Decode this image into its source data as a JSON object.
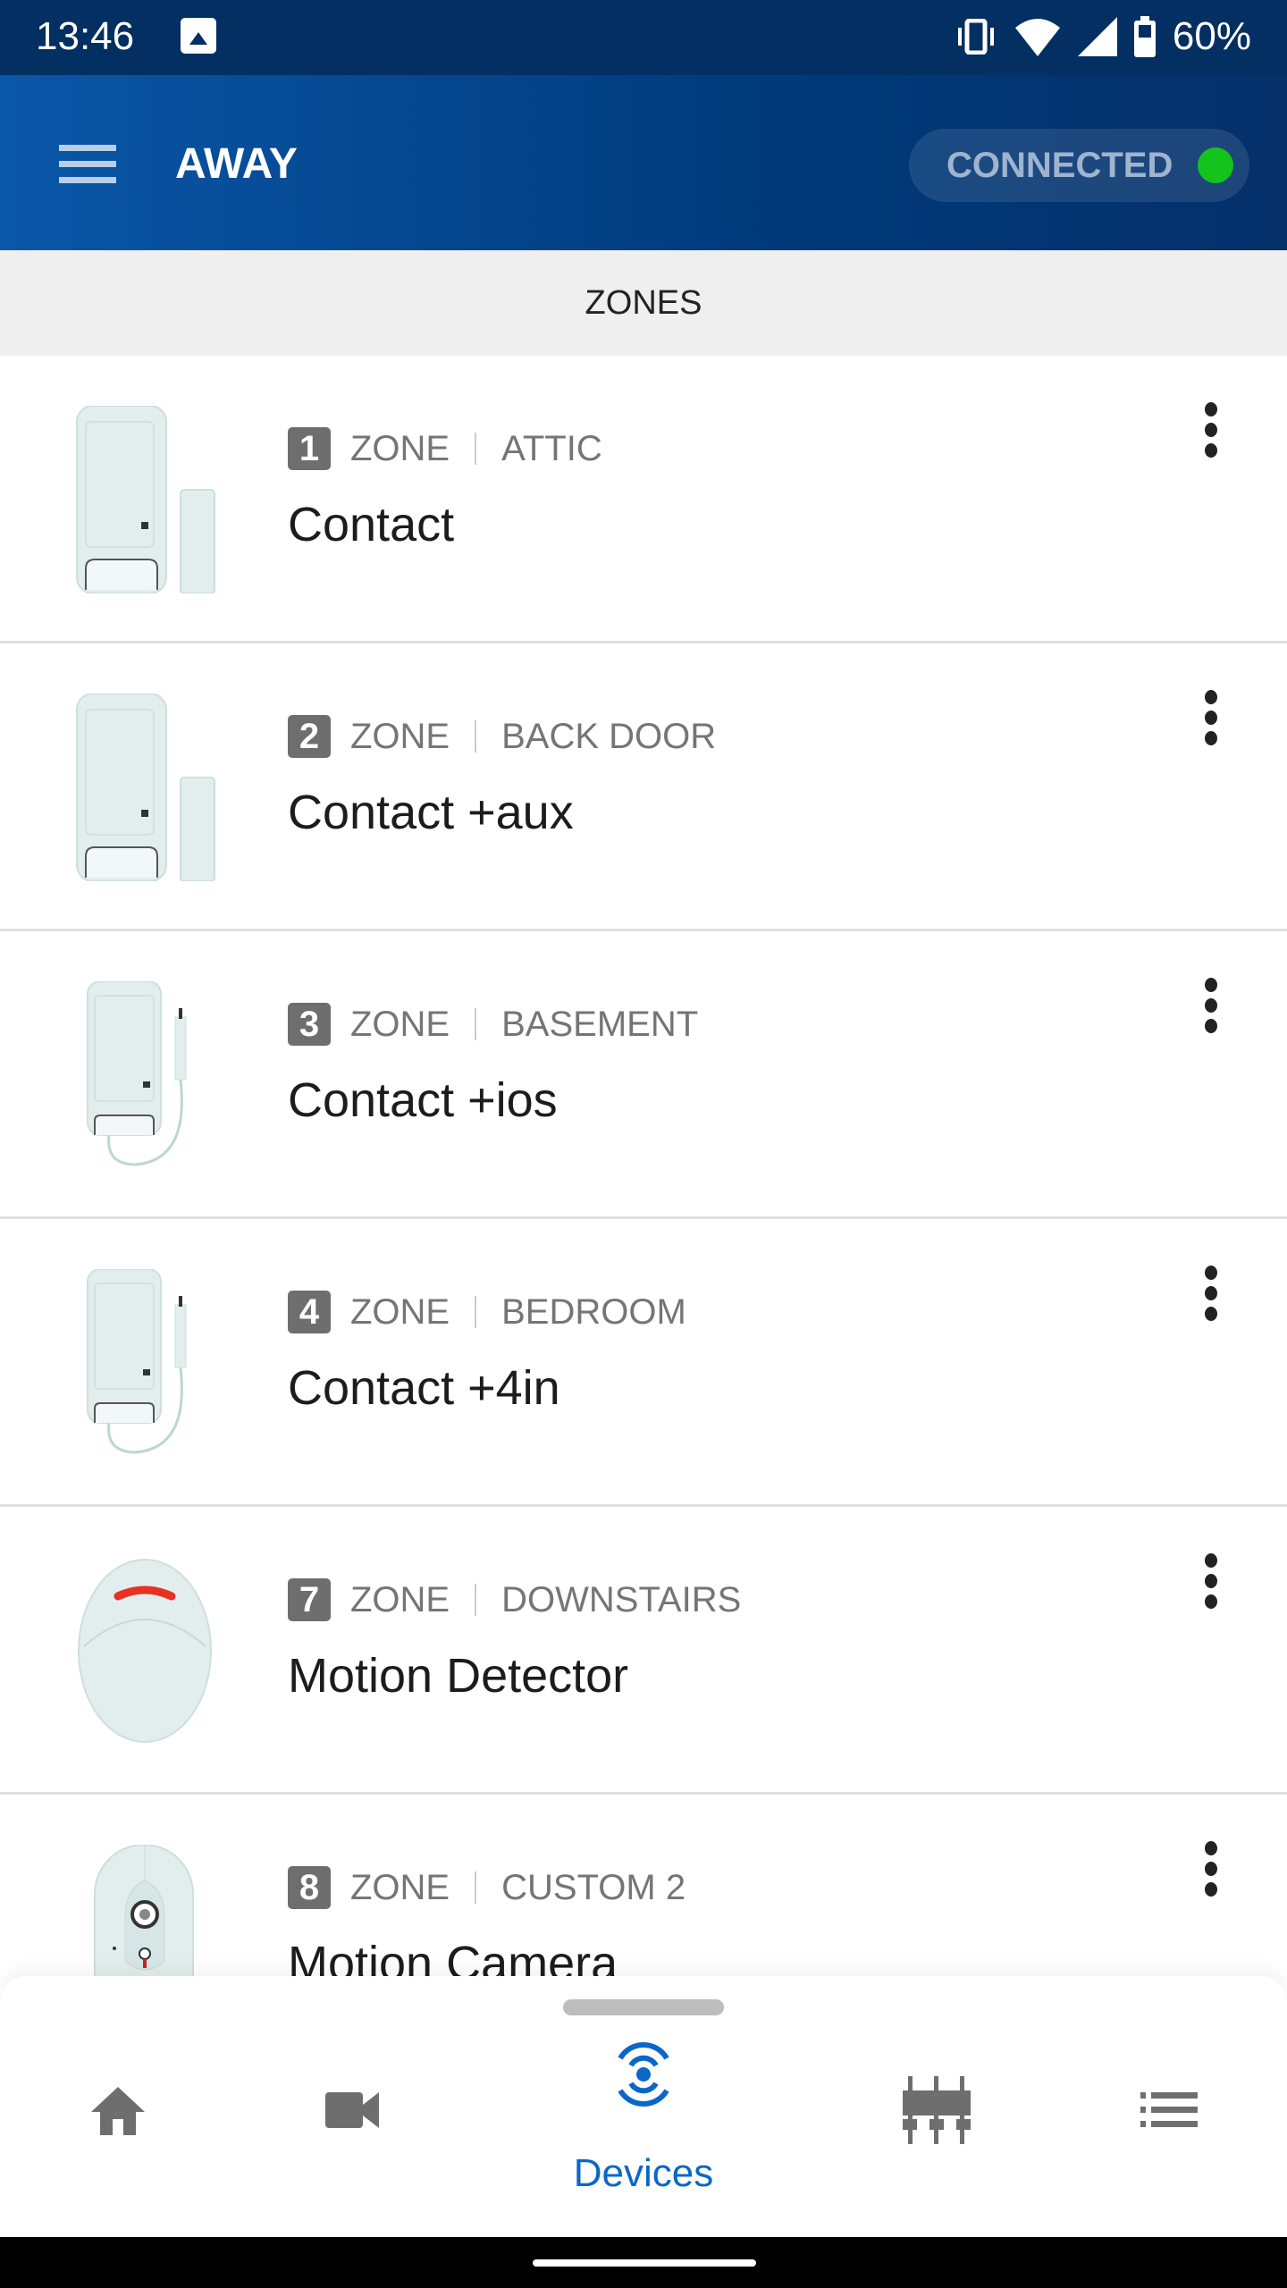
{
  "status_bar": {
    "time": "13:46",
    "battery": "60%",
    "icons": [
      "image-icon",
      "vibrate-icon",
      "wifi-icon",
      "signal-icon",
      "battery-icon"
    ]
  },
  "header": {
    "title": "AWAY",
    "connection": "CONNECTED",
    "connection_color": "#14c41c"
  },
  "section": {
    "title": "ZONES"
  },
  "zones": [
    {
      "number": "1",
      "type": "ZONE",
      "location": "ATTIC",
      "name": "Contact",
      "device": "contact"
    },
    {
      "number": "2",
      "type": "ZONE",
      "location": "BACK DOOR",
      "name": "Contact +aux",
      "device": "contact"
    },
    {
      "number": "3",
      "type": "ZONE",
      "location": "BASEMENT",
      "name": "Contact +ios",
      "device": "contact-wired"
    },
    {
      "number": "4",
      "type": "ZONE",
      "location": "BEDROOM",
      "name": "Contact +4in",
      "device": "contact-wired"
    },
    {
      "number": "7",
      "type": "ZONE",
      "location": "DOWNSTAIRS",
      "name": "Motion Detector",
      "device": "motion"
    },
    {
      "number": "8",
      "type": "ZONE",
      "location": "CUSTOM 2",
      "name": "Motion Camera",
      "device": "camera"
    }
  ],
  "bottom_nav": {
    "items": [
      {
        "icon": "home-icon"
      },
      {
        "icon": "video-camera-icon"
      },
      {
        "icon": "devices-icon",
        "label": "Devices",
        "active": true
      },
      {
        "icon": "sliders-icon"
      },
      {
        "icon": "list-icon"
      }
    ],
    "accent": "#0a67c8"
  }
}
